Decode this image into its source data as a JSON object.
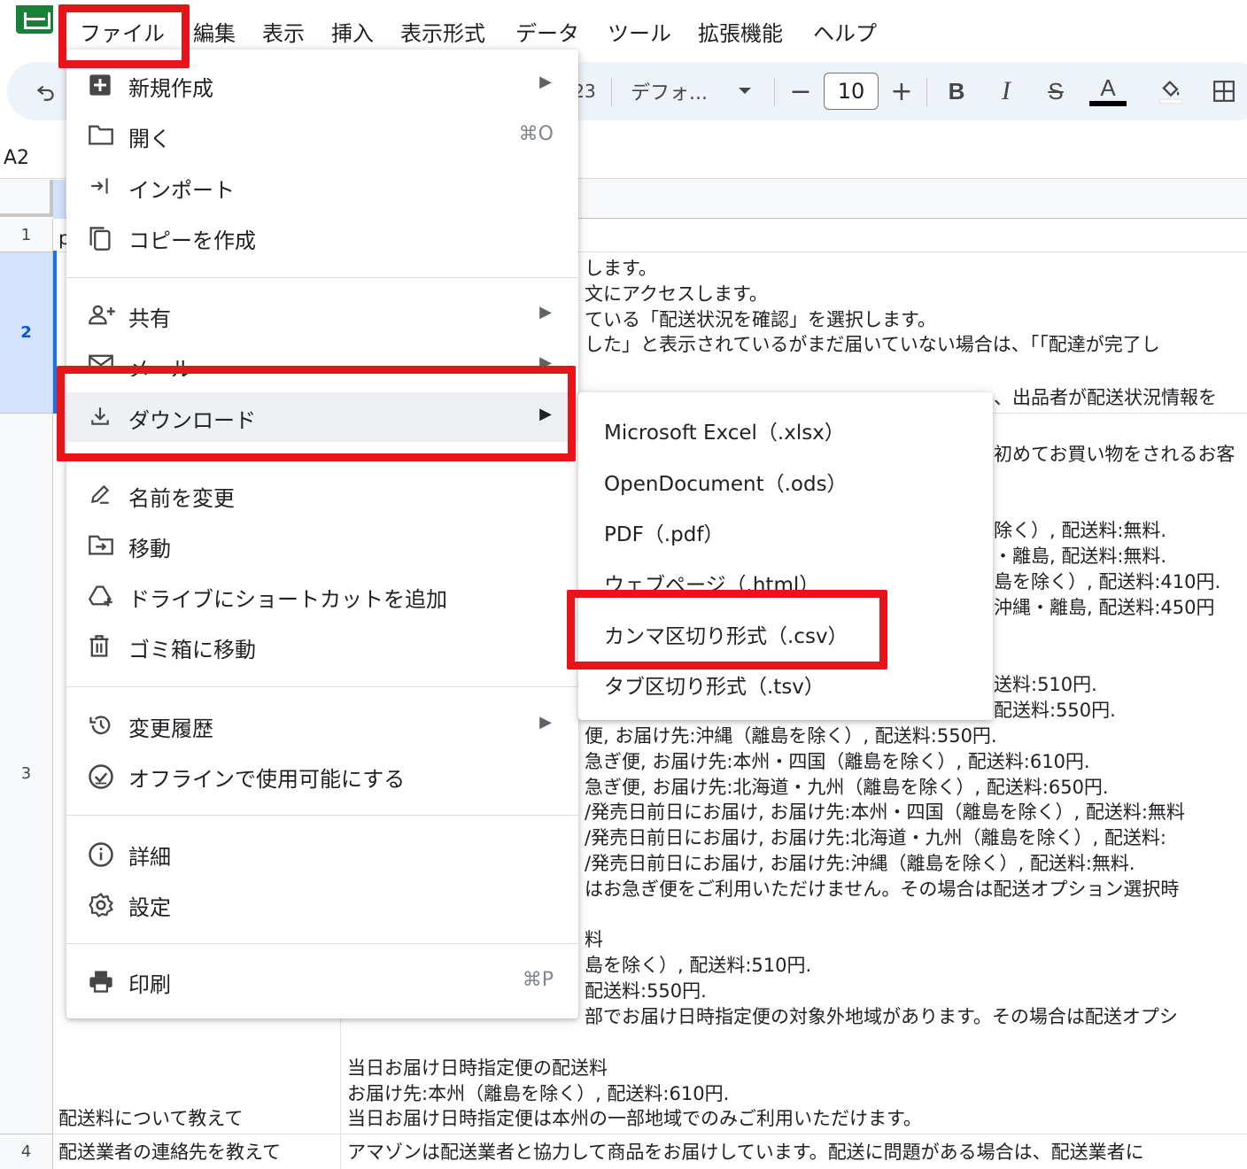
{
  "menubar": {
    "items": [
      "ファイル",
      "編集",
      "表示",
      "挿入",
      "表示形式",
      "データ",
      "ツール",
      "拡張機能",
      "ヘルプ"
    ]
  },
  "toolbar": {
    "undo_icon": "undo-icon",
    "partial_zoom": "23",
    "font_name": "デフォ...",
    "font_size": "10",
    "minus": "−",
    "plus": "+",
    "bold": "B",
    "italic": "I",
    "strike": "S",
    "text_color": "A",
    "text_color_bar": "#000000"
  },
  "formula_bar": {
    "name_box": "A2"
  },
  "grid": {
    "rows": [
      {
        "num": "1",
        "col_a_text": "p"
      },
      {
        "num": "2"
      },
      {
        "num": "3",
        "col_a_text": "配送料について教えて"
      },
      {
        "num": "4",
        "col_a_text": "配送業者の連絡先を教えて",
        "col_b_text": "アマゾンは配送業者と協力して商品をお届けしています。配送に問題がある場合は、配送業者に"
      }
    ],
    "row2_lines": [
      "します。",
      "文にアクセスします。",
      "ている「配送状況を確認」を選択します。",
      "した」と表示されているがまだ届いていない場合は、「「配達が完了し"
    ],
    "row2_line5": "、出品者が配送状況情報を",
    "row3_right_lines": [
      "初めてお買い物をされるお客",
      "",
      "",
      "除く）, 配送料:無料.",
      "・離島, 配送料:無料.",
      "島を除く）, 配送料:410円.",
      "沖縄・離島, 配送料:450円"
    ],
    "row3_mid_lines": [
      "送料:510円.",
      "配送料:550円."
    ],
    "row3_lines": [
      "便, お届け先:沖縄（離島を除く）, 配送料:550円.",
      "急ぎ便, お届け先:本州・四国（離島を除く）, 配送料:610円.",
      "急ぎ便, お届け先:北海道・九州（離島を除く）, 配送料:650円.",
      "/発売日前日にお届け, お届け先:本州・四国（離島を除く）, 配送料:無料",
      "/発売日前日にお届け, お届け先:北海道・九州（離島を除く）, 配送料:",
      "/発売日前日にお届け, お届け先:沖縄（離島を除く）, 配送料:無料.",
      "はお急ぎ便をご利用いただけません。その場合は配送オプション選択時",
      "",
      "料",
      "島を除く）, 配送料:510円.",
      "配送料:550円.",
      "部でお届け日時指定便の対象外地域があります。その場合は配送オプシ",
      "",
      "当日お届け日時指定便の配送料",
      "お届け先:本州（離島を除く）, 配送料:610円.",
      "当日お届け日時指定便は本州の一部地域でのみご利用いただけます。"
    ]
  },
  "file_menu": {
    "items": [
      {
        "label": "新規作成",
        "icon": "new-sheet-icon",
        "arrow": "▶"
      },
      {
        "label": "開く",
        "icon": "folder-icon",
        "shortcut": "⌘O"
      },
      {
        "label": "インポート",
        "icon": "import-icon"
      },
      {
        "label": "コピーを作成",
        "icon": "copy-icon"
      },
      {
        "label": "共有",
        "icon": "share-person-icon",
        "arrow": "▶"
      },
      {
        "label": "メール",
        "icon": "mail-icon",
        "arrow": "▶"
      },
      {
        "label": "ダウンロード",
        "icon": "download-icon",
        "arrow": "▶"
      },
      {
        "label": "名前を変更",
        "icon": "rename-icon"
      },
      {
        "label": "移動",
        "icon": "move-folder-icon"
      },
      {
        "label": "ドライブにショートカットを追加",
        "icon": "drive-shortcut-icon"
      },
      {
        "label": "ゴミ箱に移動",
        "icon": "trash-icon"
      },
      {
        "label": "変更履歴",
        "icon": "history-icon",
        "arrow": "▶"
      },
      {
        "label": "オフラインで使用可能にする",
        "icon": "offline-check-icon"
      },
      {
        "label": "詳細",
        "icon": "info-icon"
      },
      {
        "label": "設定",
        "icon": "gear-icon"
      },
      {
        "label": "印刷",
        "icon": "print-icon",
        "shortcut": "⌘P"
      }
    ]
  },
  "download_submenu": {
    "items": [
      "Microsoft Excel（.xlsx）",
      "OpenDocument（.ods）",
      "PDF（.pdf）",
      "ウェブページ（.html）",
      "カンマ区切り形式（.csv）",
      "タブ区切り形式（.tsv）"
    ]
  },
  "colors": {
    "annotation_red": "#e8141a",
    "sheets_green": "#188038",
    "selection_blue": "#1a73e8"
  }
}
